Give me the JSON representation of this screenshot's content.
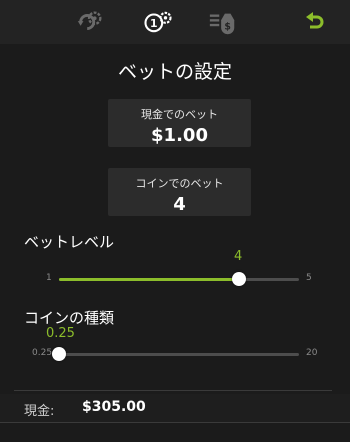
{
  "toolbar": {
    "icons": [
      "auto-spin-gear-icon",
      "bet-settings-icon",
      "paytable-coins-icon",
      "back-arrow-icon"
    ],
    "accent": "#8cbd2b"
  },
  "title": "ベットの設定",
  "cash_bet": {
    "label": "現金でのベット",
    "value": "$1.00"
  },
  "coin_bet": {
    "label": "コインでのベット",
    "value": "4"
  },
  "bet_level": {
    "label": "ベットレベル",
    "min_label": "1",
    "max_label": "5",
    "current_label": "4",
    "level": 0.75
  },
  "coin_type": {
    "label": "コインの種類",
    "min_label": "0.25",
    "max_label": "20",
    "current_label": "0.25",
    "level": 0
  },
  "footer": {
    "cash_label": "現金:",
    "cash_value": "$305.00"
  }
}
